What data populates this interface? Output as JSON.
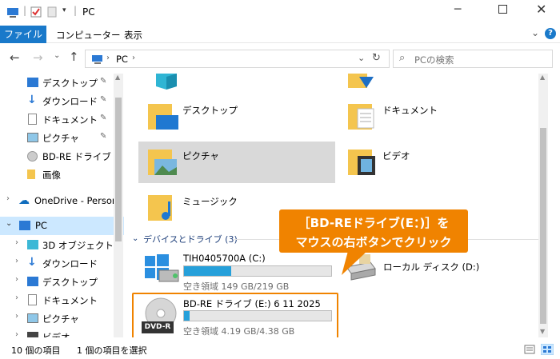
{
  "window": {
    "title": "PC"
  },
  "ribbon": {
    "tabs": [
      "ファイル",
      "コンピューター",
      "表示"
    ]
  },
  "address": {
    "location": "PC",
    "search_placeholder": "PCの検索"
  },
  "nav": {
    "quick": [
      {
        "label": "デスクトップ",
        "pinned": true
      },
      {
        "label": "ダウンロード",
        "pinned": true
      },
      {
        "label": "ドキュメント",
        "pinned": true
      },
      {
        "label": "ピクチャ",
        "pinned": true
      },
      {
        "label": "BD-RE ドライブ (E:",
        "pinned": false
      },
      {
        "label": "画像",
        "pinned": false
      }
    ],
    "onedrive": "OneDrive - Person",
    "pc": "PC",
    "pc_children": [
      "3D オブジェクト",
      "ダウンロード",
      "デスクトップ",
      "ドキュメント",
      "ピクチャ",
      "ビデオ"
    ]
  },
  "folders": [
    {
      "name": "デスクトップ"
    },
    {
      "name": "ドキュメント"
    },
    {
      "name": "ピクチャ"
    },
    {
      "name": "ビデオ"
    },
    {
      "name": "ミュージック"
    }
  ],
  "devices": {
    "header": "デバイスとドライブ (3)",
    "drives": [
      {
        "name": "TIH0405700A (C:)",
        "free": "空き領域 149 GB/219 GB",
        "used_fraction": 0.32
      },
      {
        "name": "ローカル ディスク (D:)"
      },
      {
        "name": "BD-RE ドライブ (E:) 6 11 2025",
        "free": "空き領域 4.19 GB/4.38 GB",
        "used_fraction": 0.04,
        "badge": "DVD-R"
      }
    ]
  },
  "callout": {
    "line1": "［BD-REドライブ(E：)］を",
    "line2": "マウスの右ボタンでクリック"
  },
  "status": {
    "count": "10 個の項目",
    "selected": "1 個の項目を選択"
  },
  "colors": {
    "accent": "#1979ca",
    "callout": "#f08300",
    "selection": "#d9d9d9"
  }
}
